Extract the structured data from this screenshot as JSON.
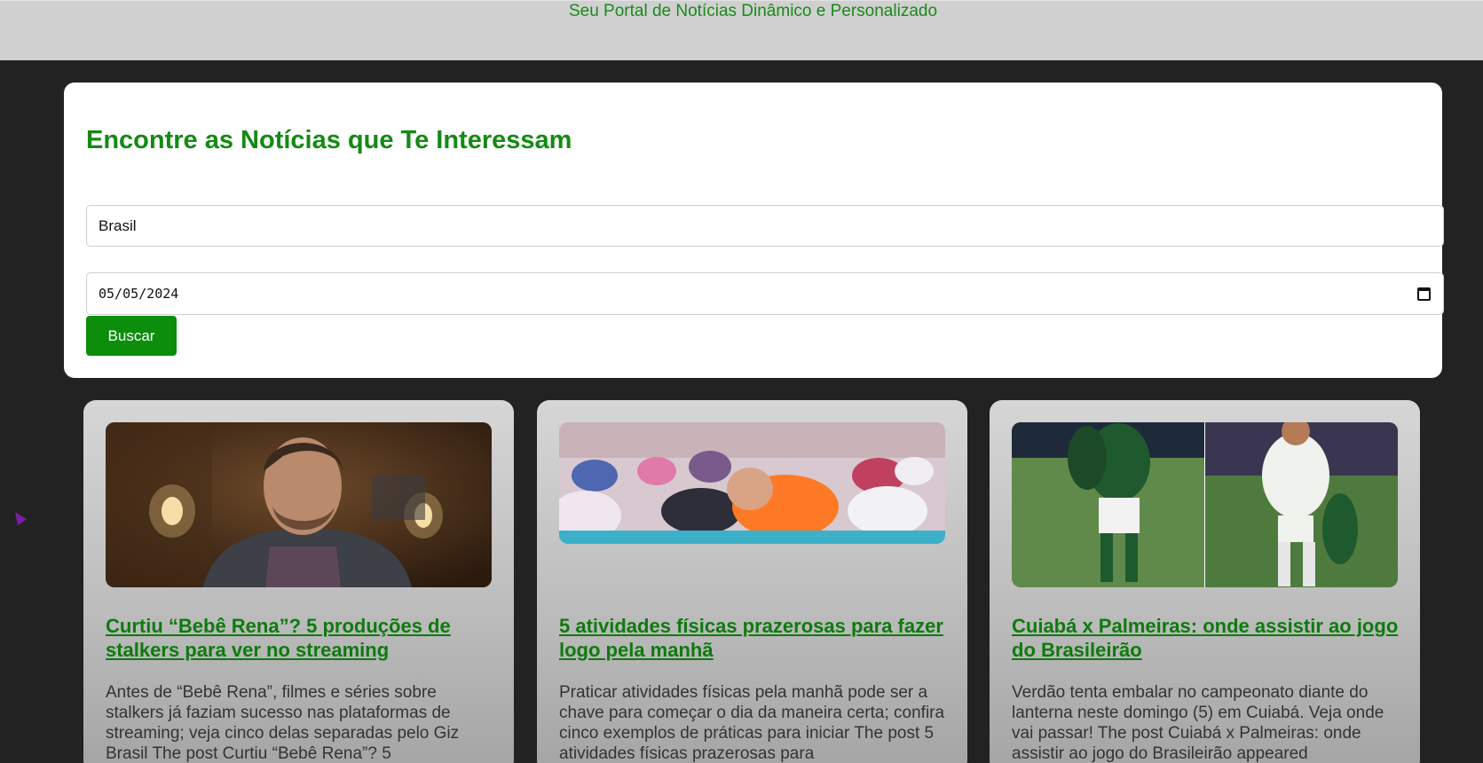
{
  "header": {
    "tagline": "Seu Portal de Notícias Dinâmico e Personalizado"
  },
  "search": {
    "title": "Encontre as Notícias que Te Interessam",
    "query_value": "Brasil",
    "date_value": "05/05/2024",
    "button_label": "Buscar"
  },
  "articles": [
    {
      "title": "Curtiu “Bebê Rena”? 5 produções de stalkers para ver no streaming",
      "description": "Antes de “Bebê Rena”, filmes e séries sobre stalkers já faziam sucesso nas plataformas de streaming; veja cinco delas separadas pelo Giz Brasil The post Curtiu “Bebê Rena”? 5"
    },
    {
      "title": "5 atividades físicas prazerosas para fazer logo pela manhã",
      "description": "Praticar atividades físicas pela manhã pode ser a chave para começar o dia da maneira certa; confira cinco exemplos de práticas para iniciar The post 5 atividades físicas prazerosas para"
    },
    {
      "title": "Cuiabá x Palmeiras: onde assistir ao jogo do Brasileirão",
      "description": "Verdão tenta embalar no campeonato diante do lanterna neste domingo (5) em Cuiabá. Veja onde vai passar! The post Cuiabá x Palmeiras: onde assistir ao jogo do Brasileirão appeared"
    }
  ],
  "colors": {
    "accent_green": "#138a13",
    "button_green": "#0c8d0c",
    "page_background": "#222222",
    "header_background": "#d0d0d0"
  }
}
